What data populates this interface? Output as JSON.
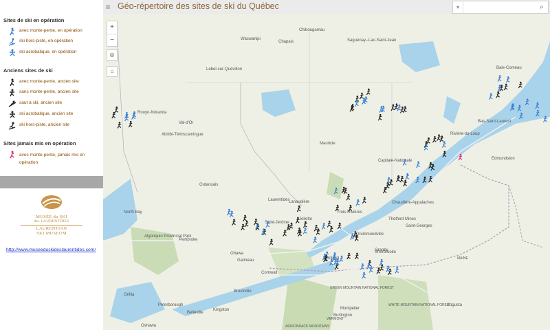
{
  "app": {
    "title": "Géo-répertoire des sites de ski du Québec",
    "menu_icon": "hamburger-icon",
    "search_placeholder": "",
    "search_icon": "search-icon",
    "dropdown_icon": "chevron-down-icon"
  },
  "legend": {
    "operating_title": "Sites de ski en opération",
    "operating_items": [
      {
        "label": "avec monte-pente, en opération",
        "color": "#3a7fd5",
        "icon": "skier-lift-icon"
      },
      {
        "label": "ski hors-piste, en opération",
        "color": "#3a7fd5",
        "icon": "backcountry-skier-icon"
      },
      {
        "label": "ski acrobatique, en opération",
        "color": "#3a7fd5",
        "icon": "freestyle-skier-icon"
      }
    ],
    "former_title": "Anciens sites de ski",
    "former_items": [
      {
        "label": "avec monte-pente, ancien site",
        "color": "#222222",
        "icon": "skier-lift-icon"
      },
      {
        "label": "sans monte-pente, ancien site",
        "color": "#222222",
        "icon": "skier-nolift-icon"
      },
      {
        "label": "saut à ski, ancien site",
        "color": "#222222",
        "icon": "ski-jump-icon"
      },
      {
        "label": "ski acrobatique, ancien site",
        "color": "#222222",
        "icon": "freestyle-skier-icon"
      },
      {
        "label": "ski hors-piste, ancien site",
        "color": "#222222",
        "icon": "backcountry-skier-icon"
      }
    ],
    "never_title": "Sites jamais mis en opération",
    "never_items": [
      {
        "label": "avec monte-pente, jamais mis en opération",
        "color": "#e0307a",
        "icon": "skier-lift-icon"
      }
    ]
  },
  "logo": {
    "line1": "MUSÉE du SKI",
    "line2": "des LAURENTIDES",
    "line3": "LAURENTIAN",
    "line4": "SKI MUSEUM"
  },
  "link": {
    "text": "http://www.museeduskideslaurentides.com/"
  },
  "map": {
    "zoom_in": "+",
    "zoom_out": "−",
    "locate_icon": "locate-icon",
    "home_icon": "home-icon",
    "places": [
      {
        "name": "Chibougamau"
      },
      {
        "name": "Saguenay--Lac-Saint-Jean"
      },
      {
        "name": "Chapais"
      },
      {
        "name": "Waswanipi"
      },
      {
        "name": "Lebel-sur-Quévillon"
      },
      {
        "name": "Rouyn-Noranda"
      },
      {
        "name": "Val-d'Or"
      },
      {
        "name": "Abitibi-Témiscamingue"
      },
      {
        "name": "Mauricie"
      },
      {
        "name": "Capitale-Nationale"
      },
      {
        "name": "Bas-Saint-Laurent"
      },
      {
        "name": "Rivière-du-Loup"
      },
      {
        "name": "Edmundston"
      },
      {
        "name": "Chaudière-Appalaches"
      },
      {
        "name": "Outaouais"
      },
      {
        "name": "Laurentides"
      },
      {
        "name": "Lanaudière"
      },
      {
        "name": "North Bay"
      },
      {
        "name": "Pembroke"
      },
      {
        "name": "Ottawa"
      },
      {
        "name": "Gatineau"
      },
      {
        "name": "Cornwall"
      },
      {
        "name": "Montréal"
      },
      {
        "name": "Sherbrooke"
      },
      {
        "name": "Brockville"
      },
      {
        "name": "Kingston"
      },
      {
        "name": "Peterborough"
      },
      {
        "name": "Belleville"
      },
      {
        "name": "Orillia"
      },
      {
        "name": "Oshawa"
      },
      {
        "name": "Burlington"
      },
      {
        "name": "Montpelier"
      },
      {
        "name": "Augusta"
      },
      {
        "name": "MAINE"
      },
      {
        "name": "VERMONT"
      },
      {
        "name": "GREEN MOUNTAIN NATIONAL FOREST"
      },
      {
        "name": "WHITE MOUNTAIN NATIONAL FOREST"
      },
      {
        "name": "ADIRONDACK MOUNTAINS"
      },
      {
        "name": "Baie-Comeau"
      },
      {
        "name": "Algonquin Provincial Park"
      },
      {
        "name": "Drummondville"
      },
      {
        "name": "Trois-Rivières"
      },
      {
        "name": "Saint-Georges"
      },
      {
        "name": "Thetford Mines"
      },
      {
        "name": "Granby"
      },
      {
        "name": "Saint-Jérôme"
      },
      {
        "name": "Joliette"
      }
    ]
  }
}
